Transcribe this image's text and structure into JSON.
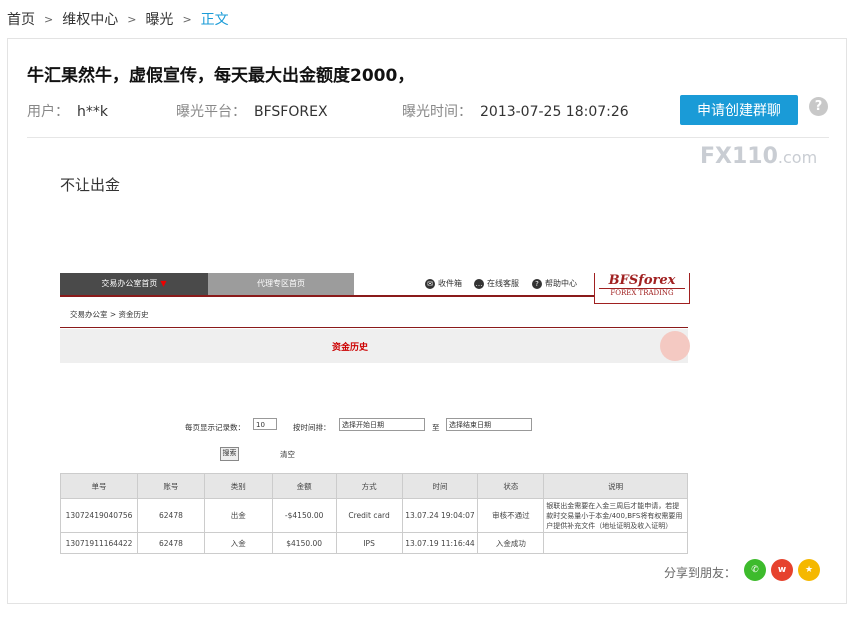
{
  "breadcrumb": {
    "items": [
      "首页",
      "维权中心",
      "曝光"
    ],
    "separator": ">",
    "current": "正文"
  },
  "post": {
    "title": "牛汇果然牛，虚假宣传，每天最大出金额度2000，",
    "user_label": "用户：",
    "user_value": "h**k",
    "platform_label": "曝光平台：",
    "platform_value": "BFSFOREX",
    "time_label": "曝光时间：",
    "time_value": "2013-07-25 18:07:26",
    "apply_button": "申请创建群聊",
    "help_icon": "?",
    "body": "不让出金"
  },
  "watermark": {
    "brand": "FX110",
    "suffix": ".com"
  },
  "screenshot": {
    "nav": {
      "tab_active": "交易办公室首页",
      "tab_active_marker": "▼",
      "tab_inactive": "代理专区首页",
      "links": [
        "收件箱",
        "在线客服",
        "帮助中心"
      ]
    },
    "logo": {
      "line1": "BFSforex",
      "line2": "FOREX TRADING"
    },
    "crumb": "交易办公室 > 资金历史",
    "page_title": "资金历史",
    "filter": {
      "per_page_label": "每页显示记录数：",
      "per_page_value": "10",
      "time_label": "按时间排：",
      "start_placeholder": "选择开始日期",
      "to_label": "至",
      "end_placeholder": "选择结束日期",
      "search_button": "搜索",
      "clear_link": "清空"
    },
    "table": {
      "headers": [
        "单号",
        "账号",
        "类别",
        "金额",
        "方式",
        "时间",
        "状态",
        "说明"
      ],
      "rows": [
        {
          "no": "13072419040756",
          "account": "62478",
          "type": "出金",
          "amount": "-$4150.00",
          "method": "Credit card",
          "time": "13.07.24 19:04:07",
          "status": "审核不通过",
          "note": "银联出金需要在入金三周后才能申请，若提款时交易量小于本金/400,BFS将有权需要用户提供补充文件（地址证明及收入证明）"
        },
        {
          "no": "13071911164422",
          "account": "62478",
          "type": "入金",
          "amount": "$4150.00",
          "method": "IPS",
          "time": "13.07.19 11:16:44",
          "status": "入金成功",
          "note": ""
        }
      ]
    }
  },
  "share": {
    "label": "分享到朋友：",
    "icons": [
      {
        "name": "wechat-icon",
        "glyph": "✆",
        "color": "#3dbb2c"
      },
      {
        "name": "weibo-icon",
        "glyph": "w",
        "color": "#e6422d"
      },
      {
        "name": "qzone-icon",
        "glyph": "★",
        "color": "#f5b800"
      }
    ]
  }
}
